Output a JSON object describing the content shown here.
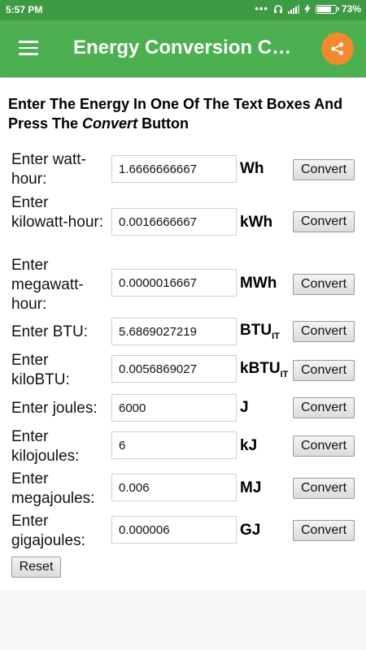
{
  "status_bar": {
    "time": "5:57 PM",
    "dots": "•••",
    "battery_pct": "73%"
  },
  "app_bar": {
    "title": "Energy Conversion Calculator"
  },
  "instructions": {
    "part1": "Enter The Energy In One Of The Text Boxes And Press The ",
    "emphasis": "Convert",
    "part2": " Button"
  },
  "rows": [
    {
      "label": "Enter watt-hour:",
      "value": "1.6666666667",
      "unit": "Wh",
      "unit_sub": "",
      "button": "Convert"
    },
    {
      "label": "Enter kilowatt-hour:",
      "value": "0.0016666667",
      "unit": "kWh",
      "unit_sub": "",
      "button": "Convert"
    },
    {
      "label": "Enter megawatt-hour:",
      "value": "0.0000016667",
      "unit": "MWh",
      "unit_sub": "",
      "button": "Convert"
    },
    {
      "label": "Enter BTU:",
      "value": "5.6869027219",
      "unit": "BTU",
      "unit_sub": "IT",
      "button": "Convert"
    },
    {
      "label": "Enter kiloBTU:",
      "value": "0.0056869027",
      "unit": "kBTU",
      "unit_sub": "IT",
      "button": "Convert"
    },
    {
      "label": "Enter joules:",
      "value": "6000",
      "unit": "J",
      "unit_sub": "",
      "button": "Convert"
    },
    {
      "label": "Enter kilojoules:",
      "value": "6",
      "unit": "kJ",
      "unit_sub": "",
      "button": "Convert"
    },
    {
      "label": "Enter megajoules:",
      "value": "0.006",
      "unit": "MJ",
      "unit_sub": "",
      "button": "Convert"
    },
    {
      "label": "Enter gigajoules:",
      "value": "0.000006",
      "unit": "GJ",
      "unit_sub": "",
      "button": "Convert"
    }
  ],
  "reset_label": "Reset",
  "colors": {
    "status_bar": "#3f9a44",
    "app_bar": "#4caf50",
    "share_button": "#f18a2c"
  }
}
